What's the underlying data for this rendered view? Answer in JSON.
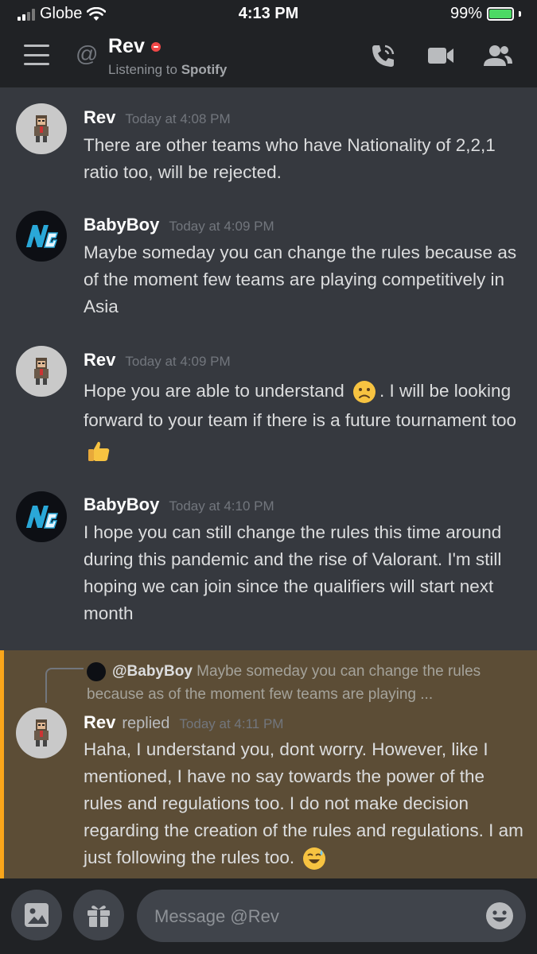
{
  "status_bar": {
    "carrier": "Globe",
    "time": "4:13 PM",
    "battery": "99%"
  },
  "header": {
    "name": "Rev",
    "activity_prefix": "Listening to ",
    "activity_app": "Spotify"
  },
  "messages": [
    {
      "author": "Rev",
      "timestamp": "Today at 4:08 PM",
      "text": "There are other teams who have Nationality of 2,2,1 ratio too, will be rejected."
    },
    {
      "author": "BabyBoy",
      "timestamp": "Today at 4:09 PM",
      "text": "Maybe someday you can change the rules because as of the moment few teams are playing competitively in Asia"
    },
    {
      "author": "Rev",
      "timestamp": "Today at 4:09 PM",
      "text_a": "Hope you are able to understand",
      "text_b": ". I will be looking forward to your team if there is a future tournament too"
    },
    {
      "author": "BabyBoy",
      "timestamp": "Today at 4:10 PM",
      "text": "I hope you can still change the rules this time around during this pandemic and the rise of Valorant. I'm still hoping we can join since the qualifiers will start next month"
    },
    {
      "author": "Rev",
      "replied_label": "replied",
      "timestamp": "Today at 4:11 PM",
      "reply_to_author": "@BabyBoy",
      "reply_to_text": "Maybe someday you can change the rules because as of the moment few teams are playing ...",
      "text": "Haha, I understand you, dont worry. However, like I mentioned, I have no say towards the power of the rules and regulations too. I do not make decision regarding the creation of the rules and regulations. I am just following the rules too."
    }
  ],
  "composer": {
    "placeholder": "Message @Rev"
  },
  "colors": {
    "background": "#36393f",
    "header": "#202225",
    "mention_bg": "#5c4d36",
    "mention_bar": "#faa61a",
    "dnd": "#f04747"
  }
}
